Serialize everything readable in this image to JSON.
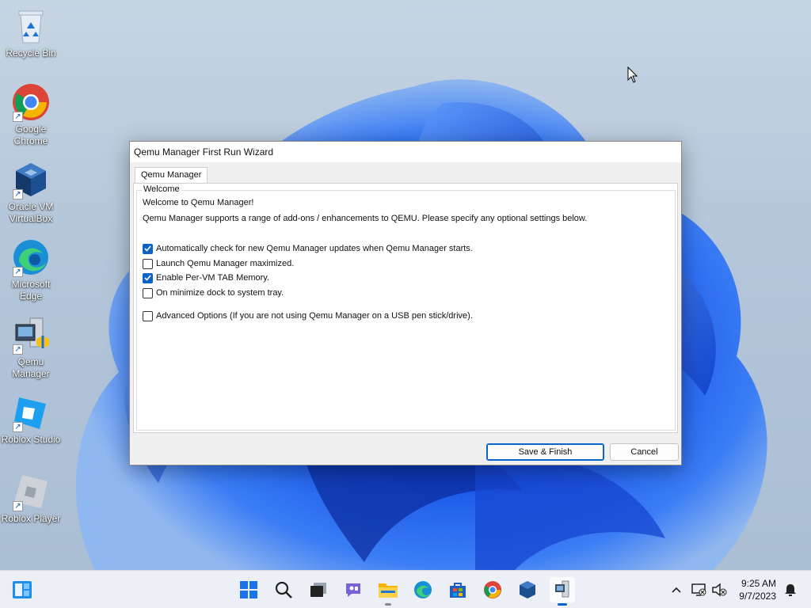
{
  "desktop": {
    "icons": [
      {
        "label": "Recycle Bin",
        "icon": "recycle-bin-icon"
      },
      {
        "label": "Google Chrome",
        "icon": "chrome-icon"
      },
      {
        "label": "Oracle VM VirtualBox",
        "icon": "virtualbox-icon"
      },
      {
        "label": "Microsoft Edge",
        "icon": "edge-icon"
      },
      {
        "label": "Qemu Manager",
        "icon": "qemu-manager-icon"
      },
      {
        "label": "Roblox Studio",
        "icon": "roblox-studio-icon"
      },
      {
        "label": "Roblox Player",
        "icon": "roblox-player-icon"
      }
    ]
  },
  "dialog": {
    "title": "Qemu Manager First Run Wizard",
    "tab_label": "Qemu Manager",
    "group_label": "Welcome",
    "welcome_line": "Welcome to Qemu Manager!",
    "intro_line": "Qemu Manager supports a range of add-ons / enhancements to QEMU.  Please specify any optional settings below.",
    "options": [
      {
        "label": "Automatically check for new Qemu Manager updates when Qemu Manager starts.",
        "checked": true
      },
      {
        "label": "Launch Qemu Manager maximized.",
        "checked": false
      },
      {
        "label": "Enable Per-VM TAB Memory.",
        "checked": true
      },
      {
        "label": "On minimize dock to system tray.",
        "checked": false
      },
      {
        "label": "Advanced Options (If you are not using Qemu Manager on a USB pen stick/drive).",
        "checked": false
      }
    ],
    "save_label": "Save & Finish",
    "cancel_label": "Cancel"
  },
  "taskbar": {
    "apps": [
      "widgets-icon",
      "start-icon",
      "search-icon",
      "task-view-icon",
      "chat-icon",
      "file-explorer-icon",
      "edge-icon",
      "store-icon",
      "chrome-icon",
      "virtualbox-icon",
      "qemu-manager-icon"
    ],
    "time": "9:25 AM",
    "date": "9/7/2023"
  },
  "colors": {
    "accent": "#0a64c8",
    "wallpaper_blue": "#1f5fe0"
  }
}
